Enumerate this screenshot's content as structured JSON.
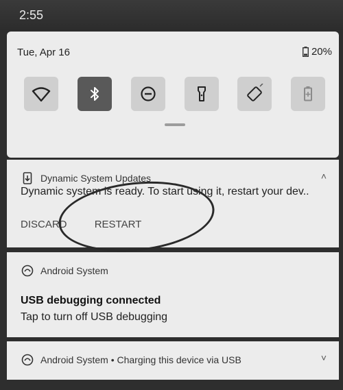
{
  "status_bar": {
    "time": "2:55"
  },
  "quick_settings": {
    "date": "Tue, Apr 16",
    "battery": "20%",
    "tiles": [
      {
        "icon": "wifi-icon",
        "active": false
      },
      {
        "icon": "bluetooth-icon",
        "active": true
      },
      {
        "icon": "do-not-disturb-icon",
        "active": false
      },
      {
        "icon": "flashlight-icon",
        "active": false
      },
      {
        "icon": "auto-rotate-icon",
        "active": false
      },
      {
        "icon": "battery-saver-icon",
        "active": false
      }
    ]
  },
  "notifications": [
    {
      "app": "Dynamic System Updates",
      "body": "Dynamic system is ready. To start using it, restart your dev..",
      "actions": {
        "discard": "DISCARD",
        "restart": "RESTART"
      }
    },
    {
      "app": "Android System",
      "title": "USB debugging connected",
      "text": "Tap to turn off USB debugging"
    },
    {
      "app_line": "Android System • Charging this device via USB"
    }
  ]
}
